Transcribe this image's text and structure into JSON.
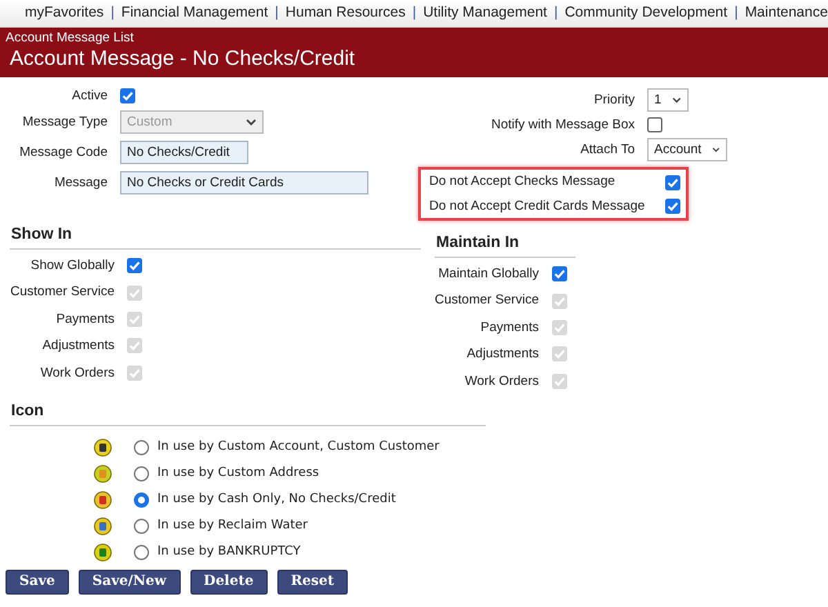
{
  "nav": {
    "links": [
      "myFavorites",
      "Financial Management",
      "Human Resources",
      "Utility Management",
      "Community Development",
      "Maintenance"
    ],
    "separators": [
      "|",
      "|",
      "|",
      "|",
      "|"
    ]
  },
  "header": {
    "breadcrumb": "Account Message List",
    "title": "Account Message - No Checks/Credit"
  },
  "left_fields": [
    {
      "kind": "checkbox",
      "label": "Active",
      "checked": true,
      "disabled": false
    },
    {
      "kind": "select",
      "label": "Message Type",
      "value": "Custom",
      "disabled": true
    },
    {
      "kind": "text",
      "label": "Message Code",
      "value": "No Checks/Credit"
    },
    {
      "kind": "text",
      "label": "Message",
      "value": "No Checks or Credit Cards"
    }
  ],
  "right_fields": [
    {
      "kind": "select",
      "label": "Priority",
      "value": "1",
      "disabled": false
    },
    {
      "kind": "checkbox",
      "label": "Notify with Message Box",
      "checked": false,
      "disabled": false
    },
    {
      "kind": "select",
      "label": "Attach To",
      "value": "Account",
      "disabled": false
    }
  ],
  "highlight_group": {
    "highlighted": true,
    "items": [
      {
        "label": "Do not Accept Checks Message",
        "checked": true
      },
      {
        "label": "Do not Accept Credit Cards Message",
        "checked": true
      }
    ]
  },
  "show_in": {
    "heading": "Show In",
    "items": [
      {
        "label": "Show Globally",
        "checked": true,
        "disabled": false
      },
      {
        "label": "Customer Service",
        "checked": true,
        "disabled": true
      },
      {
        "label": "Payments",
        "checked": true,
        "disabled": true
      },
      {
        "label": "Adjustments",
        "checked": true,
        "disabled": true
      },
      {
        "label": "Work Orders",
        "checked": true,
        "disabled": true
      }
    ]
  },
  "maintain_in": {
    "heading": "Maintain In",
    "items": [
      {
        "label": "Maintain Globally",
        "checked": true,
        "disabled": false
      },
      {
        "label": "Customer Service",
        "checked": true,
        "disabled": true
      },
      {
        "label": "Payments",
        "checked": true,
        "disabled": true
      },
      {
        "label": "Adjustments",
        "checked": true,
        "disabled": true
      },
      {
        "label": "Work Orders",
        "checked": true,
        "disabled": true
      }
    ]
  },
  "icon_section": {
    "heading": "Icon",
    "options": [
      {
        "label": "In use by Custom Account, Custom Customer",
        "selected": false
      },
      {
        "label": "In use by Custom Address",
        "selected": false
      },
      {
        "label": "In use by Cash Only, No Checks/Credit",
        "selected": true
      },
      {
        "label": "In use by Reclaim Water",
        "selected": false
      },
      {
        "label": "In use by BANKRUPTCY",
        "selected": false
      }
    ]
  },
  "buttons": [
    "Save",
    "Save/New",
    "Delete",
    "Reset"
  ]
}
